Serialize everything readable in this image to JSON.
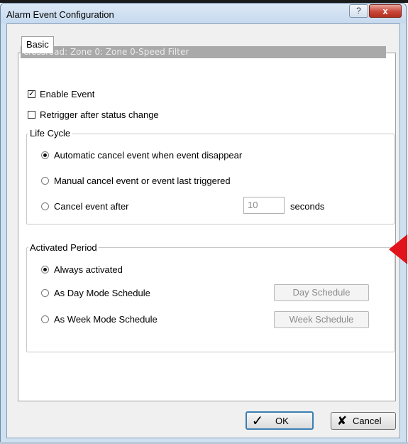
{
  "window": {
    "title": "Alarm Event Configuration",
    "help_label": "?",
    "close_label": "x"
  },
  "tabs": [
    {
      "label": "Basic",
      "selected": true
    }
  ],
  "info_bar": "crossroad: Zone 0: Zone 0-Speed Filter",
  "options": {
    "enable_event": {
      "label": "Enable Event",
      "checked": true
    },
    "retrigger": {
      "label": "Retrigger after status change",
      "checked": false
    }
  },
  "life_cycle": {
    "title": "Life Cycle",
    "choices": [
      {
        "label": "Automatic cancel event when event disappear",
        "selected": true
      },
      {
        "label": "Manual cancel event or event last triggered",
        "selected": false
      },
      {
        "label": "Cancel event after",
        "selected": false
      }
    ],
    "cancel_after_value": "10",
    "cancel_after_unit": "seconds"
  },
  "activated_period": {
    "title": "Activated Period",
    "choices": [
      {
        "label": "Always activated",
        "selected": true
      },
      {
        "label": "As Day Mode Schedule",
        "selected": false
      },
      {
        "label": "As Week Mode Schedule",
        "selected": false
      }
    ],
    "day_schedule_label": "Day Schedule",
    "week_schedule_label": "Week Schedule"
  },
  "footer": {
    "ok_label": "OK",
    "cancel_label": "Cancel"
  },
  "colors": {
    "annotation_arrow": "#e0141a",
    "info_bar_bg": "#a9a9a9"
  },
  "icons": {
    "ok": "checkmark-icon",
    "cancel": "x-icon",
    "annotation": "red-arrow-icon"
  }
}
